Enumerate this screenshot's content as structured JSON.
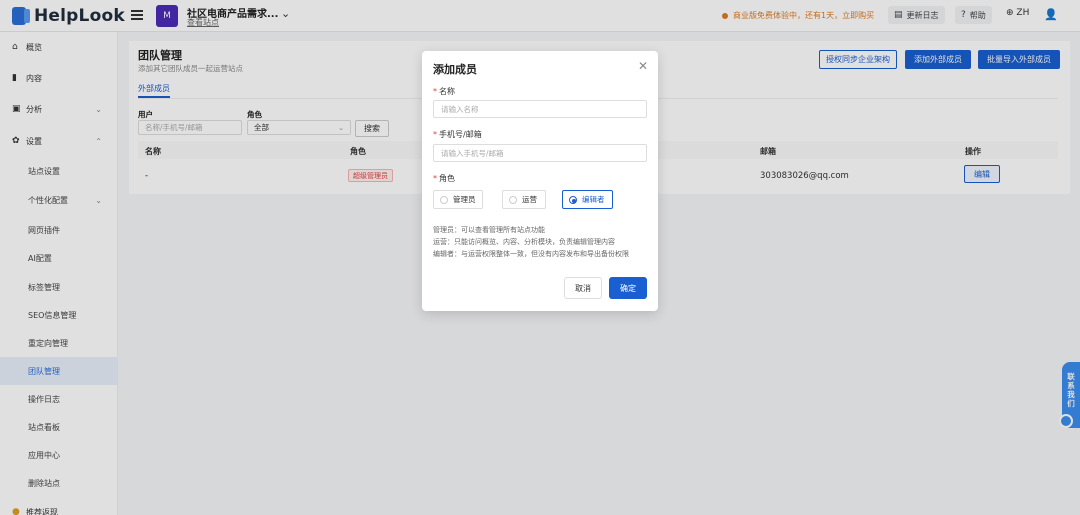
{
  "app": {
    "logo_text": "HelpLook"
  },
  "site": {
    "avatar_text": "M",
    "name": "社区电商产品需求...",
    "link": "查看站点"
  },
  "topbar": {
    "trial_notice": "商业版免费体验中，还有1天，立即购买",
    "update_log": "更新日志",
    "help": "帮助",
    "language": "ZH"
  },
  "sidebar": {
    "items": [
      {
        "label": "概览",
        "icon": "home-icon"
      },
      {
        "label": "内容",
        "icon": "content-icon"
      },
      {
        "label": "分析",
        "icon": "analytics-icon"
      },
      {
        "label": "设置",
        "icon": "gear-icon"
      }
    ],
    "sub_items": [
      "站点设置",
      "个性化配置",
      "网页插件",
      "AI配置",
      "标签管理",
      "SEO信息管理",
      "重定向管理",
      "团队管理",
      "操作日志",
      "站点看板",
      "应用中心",
      "删除站点"
    ],
    "bottom_item": "推荐返现",
    "active": "团队管理"
  },
  "page": {
    "title": "团队管理",
    "subtitle": "添加其它团队成员一起运营站点",
    "btn_sync": "授权同步企业架构",
    "btn_add": "添加外部成员",
    "btn_import": "批量导入外部成员",
    "tab": "外部成员",
    "filter_user_label": "用户",
    "filter_user_placeholder": "名称/手机号/邮箱",
    "filter_role_label": "角色",
    "filter_role_value": "全部",
    "search_btn": "搜索",
    "columns": [
      "名称",
      "角色",
      "邮箱",
      "操作"
    ],
    "rows": [
      {
        "name": "-",
        "role": "超级管理员",
        "email": "303083026@qq.com",
        "action": "编辑"
      }
    ]
  },
  "modal": {
    "title": "添加成员",
    "name_label": "名称",
    "name_placeholder": "请输入名称",
    "contact_label": "手机号/邮箱",
    "contact_placeholder": "请输入手机号/邮箱",
    "role_label": "角色",
    "role_options": [
      "管理员",
      "运营",
      "编辑者"
    ],
    "selected_role": "编辑者",
    "desc_admin": "管理员：可以查看管理所有站点功能",
    "desc_ops": "运营：只能访问概览、内容、分析模块，负责编辑管理内容",
    "desc_editor": "编辑者：与运营权限整体一致，但没有内容发布和导出备份权限",
    "cancel": "取消",
    "ok": "确定"
  },
  "contact_widget": {
    "label": "联系我们"
  },
  "colors": {
    "primary": "#1a5fd1",
    "trial": "#e07a1f",
    "danger": "#e04040"
  }
}
